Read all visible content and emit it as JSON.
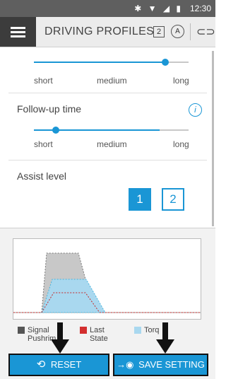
{
  "status_bar": {
    "time": "12:30",
    "icons": [
      "bluetooth-icon",
      "wifi-icon",
      "signal-icon",
      "battery-icon"
    ]
  },
  "app_bar": {
    "title": "DRIVING PROFILES",
    "badge": "2",
    "auto_label": "A"
  },
  "sensitivity_slider": {
    "value": 0.85,
    "labels": {
      "short": "short",
      "medium": "medium",
      "long": "long"
    }
  },
  "follow_up_time": {
    "title": "Follow-up time",
    "value": 0.15,
    "labels": {
      "short": "short",
      "medium": "medium",
      "long": "long"
    }
  },
  "assist_level": {
    "title": "Assist level",
    "options": [
      "1",
      "2"
    ],
    "selected": "1"
  },
  "legend": {
    "signal_pushrim": "Signal\nPushrim",
    "last_state": "Last\nState",
    "torque": "Torq"
  },
  "buttons": {
    "reset": "RESET",
    "save": "SAVE SETTING"
  },
  "colors": {
    "accent": "#1a96d5",
    "signal": "#555555",
    "last_state": "#d32f2f",
    "torque": "#a9d8ef"
  }
}
